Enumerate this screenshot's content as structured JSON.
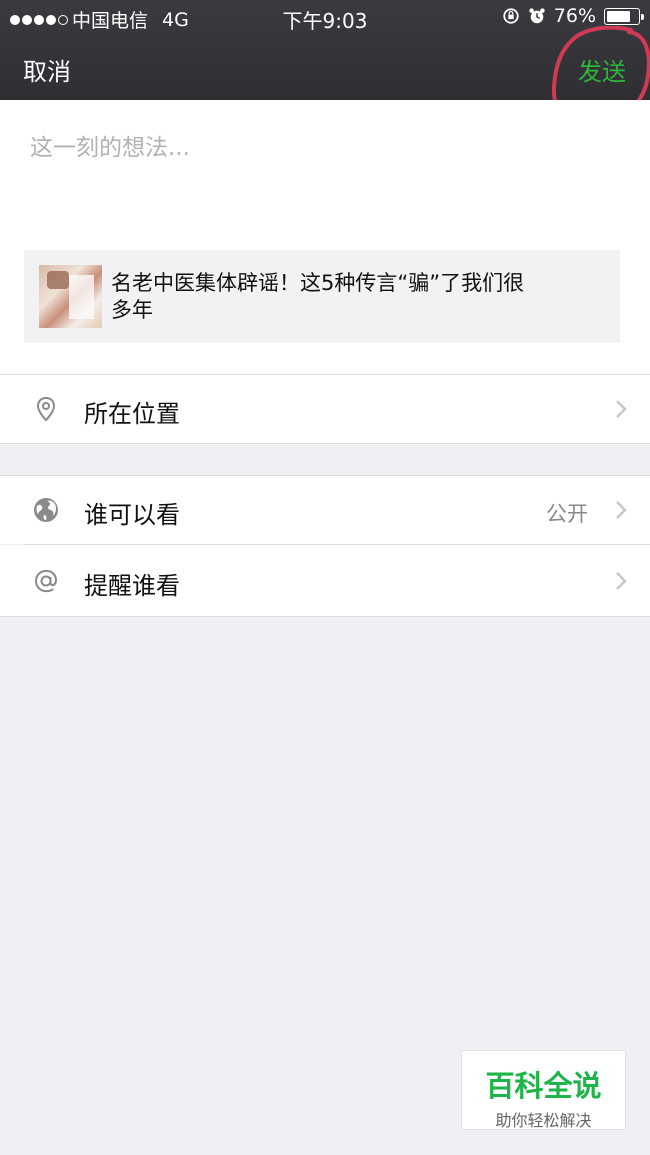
{
  "status_bar": {
    "carrier": "中国电信",
    "network": "4G",
    "time": "下午9:03",
    "battery_percent": "76%",
    "battery_level": 0.76
  },
  "nav": {
    "cancel_label": "取消",
    "send_label": "发送"
  },
  "compose": {
    "placeholder": "这一刻的想法...",
    "shared_article_title": "名老中医集体辟谣！这5种传言“骗”了我们很多年"
  },
  "options": {
    "location_label": "所在位置",
    "visibility_label": "谁可以看",
    "visibility_value": "公开",
    "remind_label": "提醒谁看"
  },
  "watermark": {
    "title": "百科全说",
    "subtitle": "助你轻松解决"
  },
  "colors": {
    "accent_green": "#2fb43a",
    "annotation_red": "#d03a55",
    "nav_bg": "#333337"
  },
  "icons": [
    "location-pin-icon",
    "globe-icon",
    "at-icon",
    "chevron-right-icon",
    "lock-rotation-icon",
    "alarm-icon",
    "battery-icon"
  ]
}
